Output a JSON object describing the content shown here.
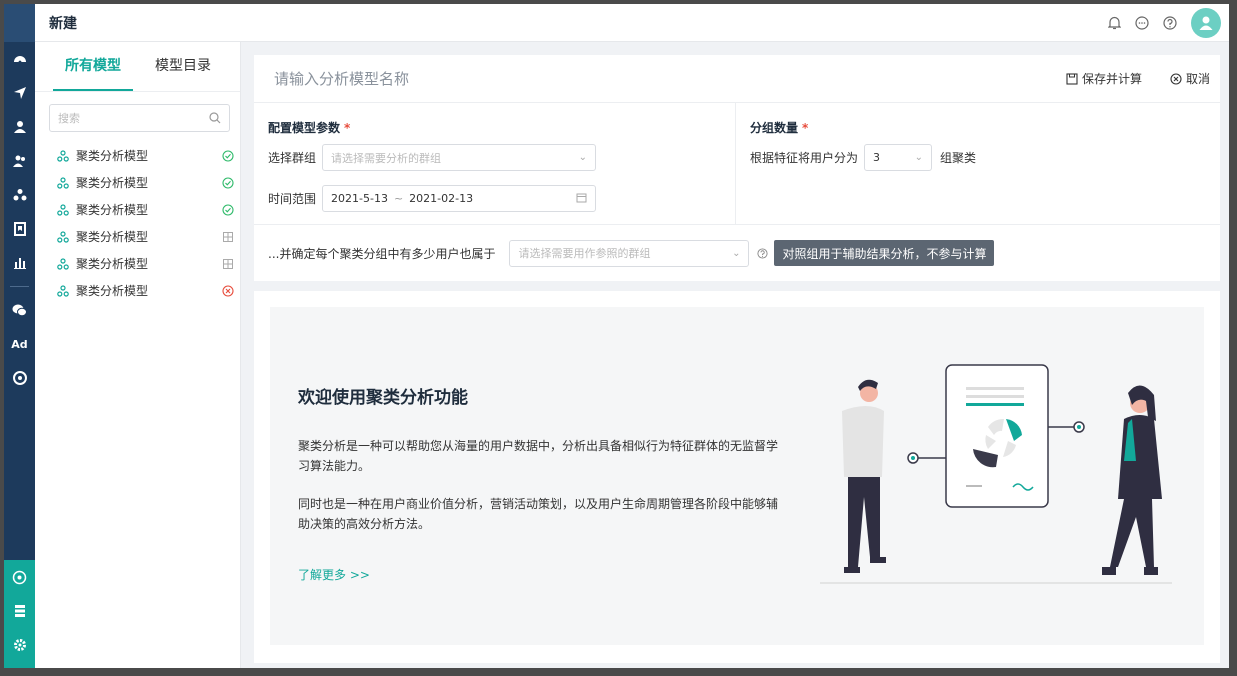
{
  "app": {
    "title": "新建"
  },
  "rail": {
    "bottom_icons": [
      "cluster-icon",
      "storage-icon",
      "settings-icon"
    ]
  },
  "sidebar": {
    "tabs": [
      {
        "label": "所有模型",
        "active": true
      },
      {
        "label": "模型目录",
        "active": false
      }
    ],
    "search_placeholder": "搜索",
    "items": [
      {
        "label": "聚类分析模型",
        "status": "done"
      },
      {
        "label": "聚类分析模型",
        "status": "done"
      },
      {
        "label": "聚类分析模型",
        "status": "done"
      },
      {
        "label": "聚类分析模型",
        "status": "pending"
      },
      {
        "label": "聚类分析模型",
        "status": "pending"
      },
      {
        "label": "聚类分析模型",
        "status": "error"
      }
    ]
  },
  "main": {
    "name_placeholder": "请输入分析模型名称",
    "save_label": "保存并计算",
    "cancel_label": "取消",
    "config": {
      "title": "配置模型参数",
      "group_label": "选择群组",
      "group_placeholder": "请选择需要分析的群组",
      "time_label": "时间范围",
      "time_start": "2021-5-13",
      "time_sep": "~",
      "time_end": "2021-02-13"
    },
    "groups": {
      "title": "分组数量",
      "prefix": "根据特征将用户分为",
      "value": "3",
      "suffix": "组聚类"
    },
    "reference": {
      "label": "...并确定每个聚类分组中有多少用户也属于",
      "placeholder": "请选择需要用作参照的群组",
      "tooltip": "对照组用于辅助结果分析，不参与计算"
    },
    "welcome": {
      "title": "欢迎使用聚类分析功能",
      "para1": "聚类分析是一种可以帮助您从海量的用户数据中，分析出具备相似行为特征群体的无监督学习算法能力。",
      "para2": "同时也是一种在用户商业价值分析，营销活动策划，以及用户生命周期管理各阶段中能够辅助决策的高效分析方法。",
      "link": "了解更多 >>"
    }
  },
  "colors": {
    "accent": "#12a89a",
    "rail": "#1d3a5c",
    "error": "#e74c3c"
  }
}
